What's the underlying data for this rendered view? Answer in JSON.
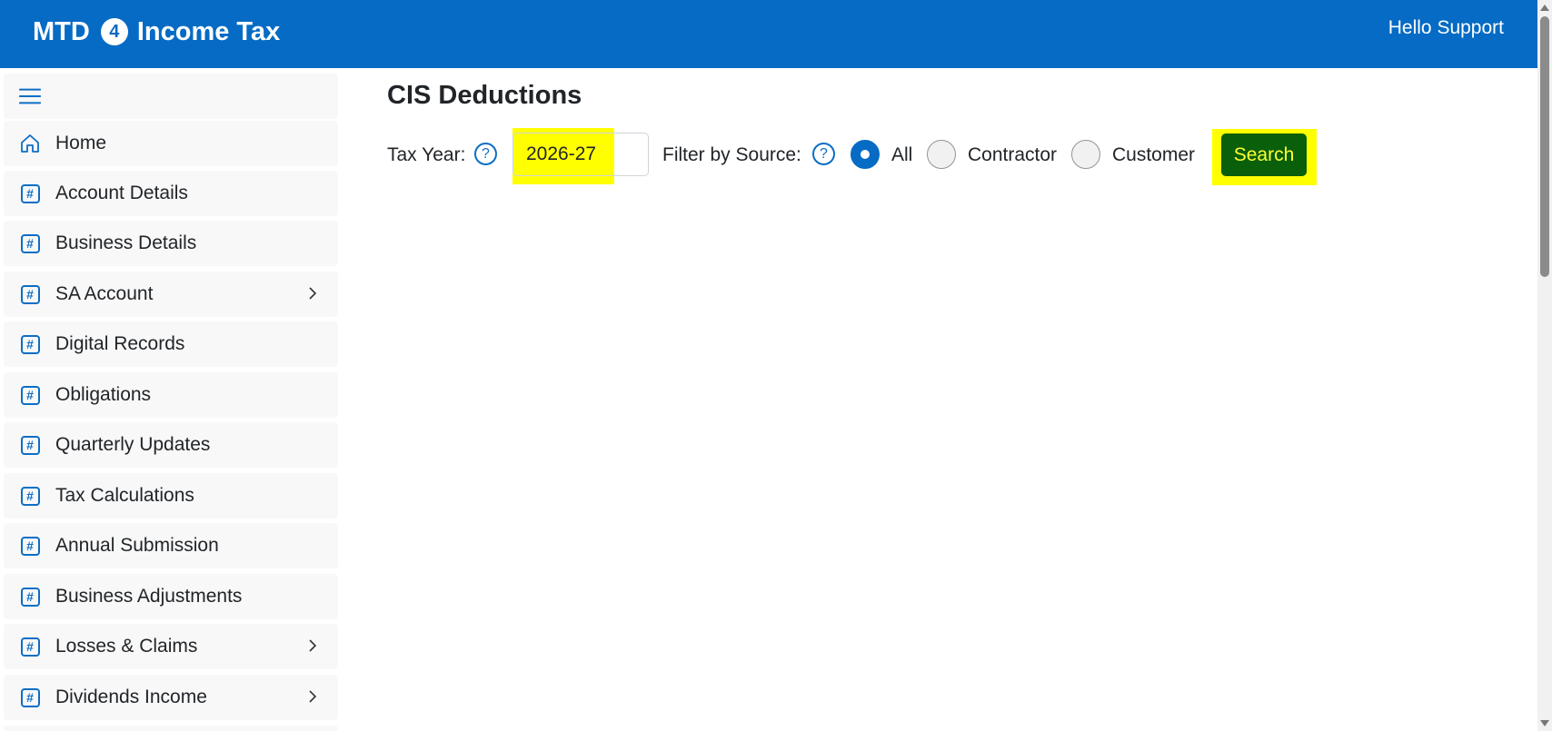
{
  "header": {
    "brand_left": "MTD",
    "brand_badge": "4",
    "brand_right": "Income Tax",
    "greeting": "Hello Support"
  },
  "sidebar": {
    "items": [
      {
        "label": "Home",
        "icon": "home-icon",
        "has_submenu": false
      },
      {
        "label": "Account Details",
        "icon": "hash-icon",
        "has_submenu": false
      },
      {
        "label": "Business Details",
        "icon": "hash-icon",
        "has_submenu": false
      },
      {
        "label": "SA Account",
        "icon": "hash-icon",
        "has_submenu": true
      },
      {
        "label": "Digital Records",
        "icon": "hash-icon",
        "has_submenu": false
      },
      {
        "label": "Obligations",
        "icon": "hash-icon",
        "has_submenu": false
      },
      {
        "label": "Quarterly Updates",
        "icon": "hash-icon",
        "has_submenu": false
      },
      {
        "label": "Tax Calculations",
        "icon": "hash-icon",
        "has_submenu": false
      },
      {
        "label": "Annual Submission",
        "icon": "hash-icon",
        "has_submenu": false
      },
      {
        "label": "Business Adjustments",
        "icon": "hash-icon",
        "has_submenu": false
      },
      {
        "label": "Losses & Claims",
        "icon": "hash-icon",
        "has_submenu": true
      },
      {
        "label": "Dividends Income",
        "icon": "hash-icon",
        "has_submenu": true
      }
    ]
  },
  "main": {
    "title": "CIS Deductions",
    "tax_year_label": "Tax Year:",
    "tax_year_value": "2026-27",
    "filter_label": "Filter by Source:",
    "filter_options": [
      {
        "label": "All",
        "checked": true
      },
      {
        "label": "Contractor",
        "checked": false
      },
      {
        "label": "Customer",
        "checked": false
      }
    ],
    "search_label": "Search",
    "help_glyph": "?"
  },
  "colors": {
    "header_bg": "#056bc4",
    "accent": "#0d6ec4",
    "search_bg": "#0a5f0a",
    "highlight": "#ffff00"
  }
}
